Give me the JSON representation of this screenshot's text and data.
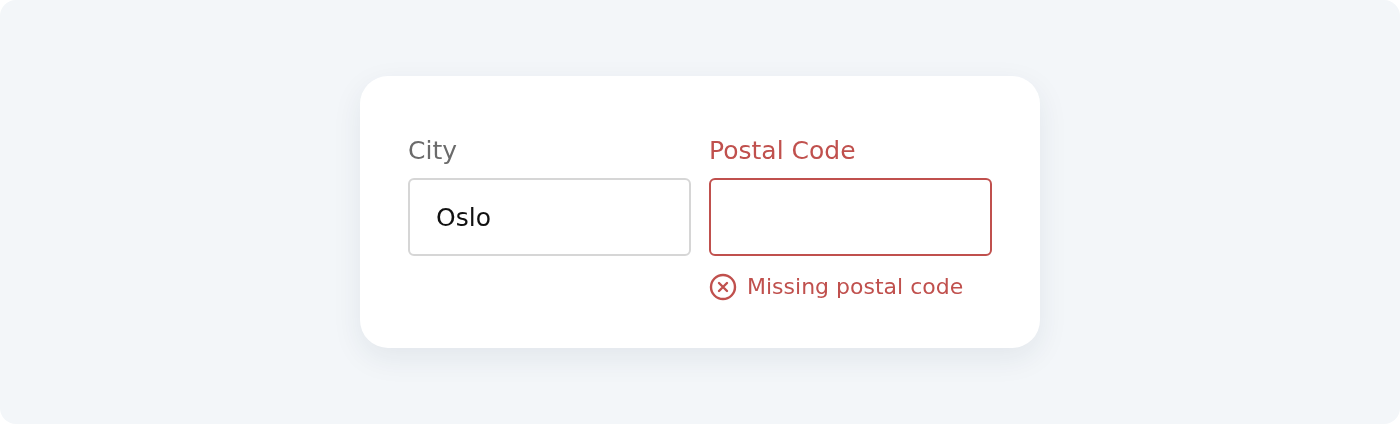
{
  "fields": [
    {
      "label": "City",
      "value": "Oslo",
      "invalid": false
    },
    {
      "label": "Postal Code",
      "invalid": true,
      "error": "Missing postal code"
    }
  ]
}
